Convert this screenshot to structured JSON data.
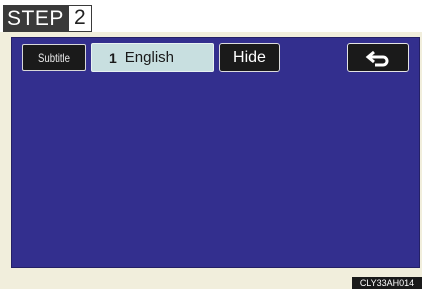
{
  "step": {
    "label": "STEP",
    "number": "2"
  },
  "toolbar": {
    "subtitle_label": "Subtitle",
    "language_number": "1",
    "language_name": "English",
    "hide_label": "Hide",
    "back_icon": "return-arrow-icon"
  },
  "figure_code": "CLY33AH014",
  "colors": {
    "screen_bg": "#332f8e",
    "frame_bg": "#f1eedc",
    "selected_field": "#c8dfe0",
    "button_bg": "#1a1a1a"
  }
}
